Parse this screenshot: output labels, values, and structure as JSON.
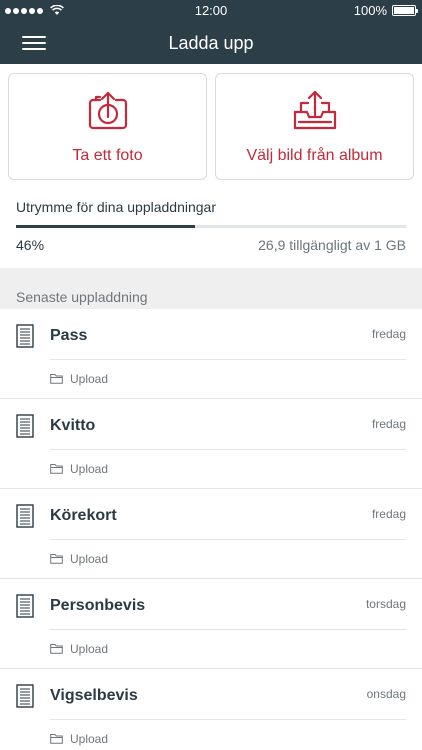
{
  "status_bar": {
    "time": "12:00",
    "battery": "100%",
    "signal_dots": 5,
    "battery_level": 1.0
  },
  "nav": {
    "title": "Ladda upp"
  },
  "actions": {
    "take_photo_label": "Ta ett foto",
    "choose_album_label": "Välj bild från album"
  },
  "storage": {
    "title": "Utrymme för dina uppladdningar",
    "used_percent_text": "46%",
    "available_text": "26,9 tillgängligt av 1 GB",
    "used_fraction": 0.46
  },
  "recent": {
    "title": "Senaste uppladdning",
    "items": [
      {
        "title": "Pass",
        "day": "fredag",
        "folder": "Upload"
      },
      {
        "title": "Kvitto",
        "day": "fredag",
        "folder": "Upload"
      },
      {
        "title": "Körekort",
        "day": "fredag",
        "folder": "Upload"
      },
      {
        "title": "Personbevis",
        "day": "torsdag",
        "folder": "Upload"
      },
      {
        "title": "Vigselbevis",
        "day": "onsdag",
        "folder": "Upload"
      }
    ]
  },
  "colors": {
    "navbar": "#2c3e48",
    "accent": "#c52a3b",
    "section_bg": "#efefef"
  },
  "icons": {
    "menu": "hamburger-menu-icon",
    "camera": "camera-upload-icon",
    "album": "tray-upload-icon",
    "document": "document-icon",
    "folder": "folder-icon"
  }
}
